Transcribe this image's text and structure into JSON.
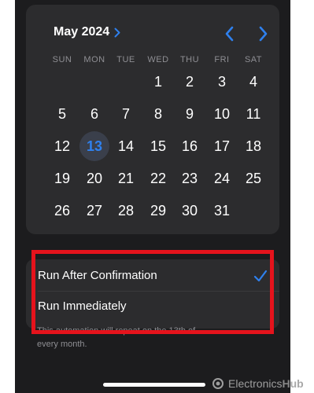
{
  "calendar": {
    "month_label": "May 2024",
    "weekdays": [
      "SUN",
      "MON",
      "TUE",
      "WED",
      "THU",
      "FRI",
      "SAT"
    ],
    "days": [
      "1",
      "2",
      "3",
      "4",
      "5",
      "6",
      "7",
      "8",
      "9",
      "10",
      "11",
      "12",
      "13",
      "14",
      "15",
      "16",
      "17",
      "18",
      "19",
      "20",
      "21",
      "22",
      "23",
      "24",
      "25",
      "26",
      "27",
      "28",
      "29",
      "30",
      "31"
    ],
    "selected_day": "13",
    "accent_color": "#2f80ed"
  },
  "options": {
    "items": [
      {
        "label": "Run After Confirmation",
        "checked": true
      },
      {
        "label": "Run Immediately",
        "checked": false
      }
    ]
  },
  "footnote": {
    "line1": "This automation will repeat on the 13th of",
    "line2": "every month."
  },
  "watermark": {
    "text_a": "Electronics",
    "text_b": "Hub"
  },
  "colors": {
    "highlight": "#e5131c",
    "background": "#1c1c1e",
    "card": "#2c2c2e"
  }
}
